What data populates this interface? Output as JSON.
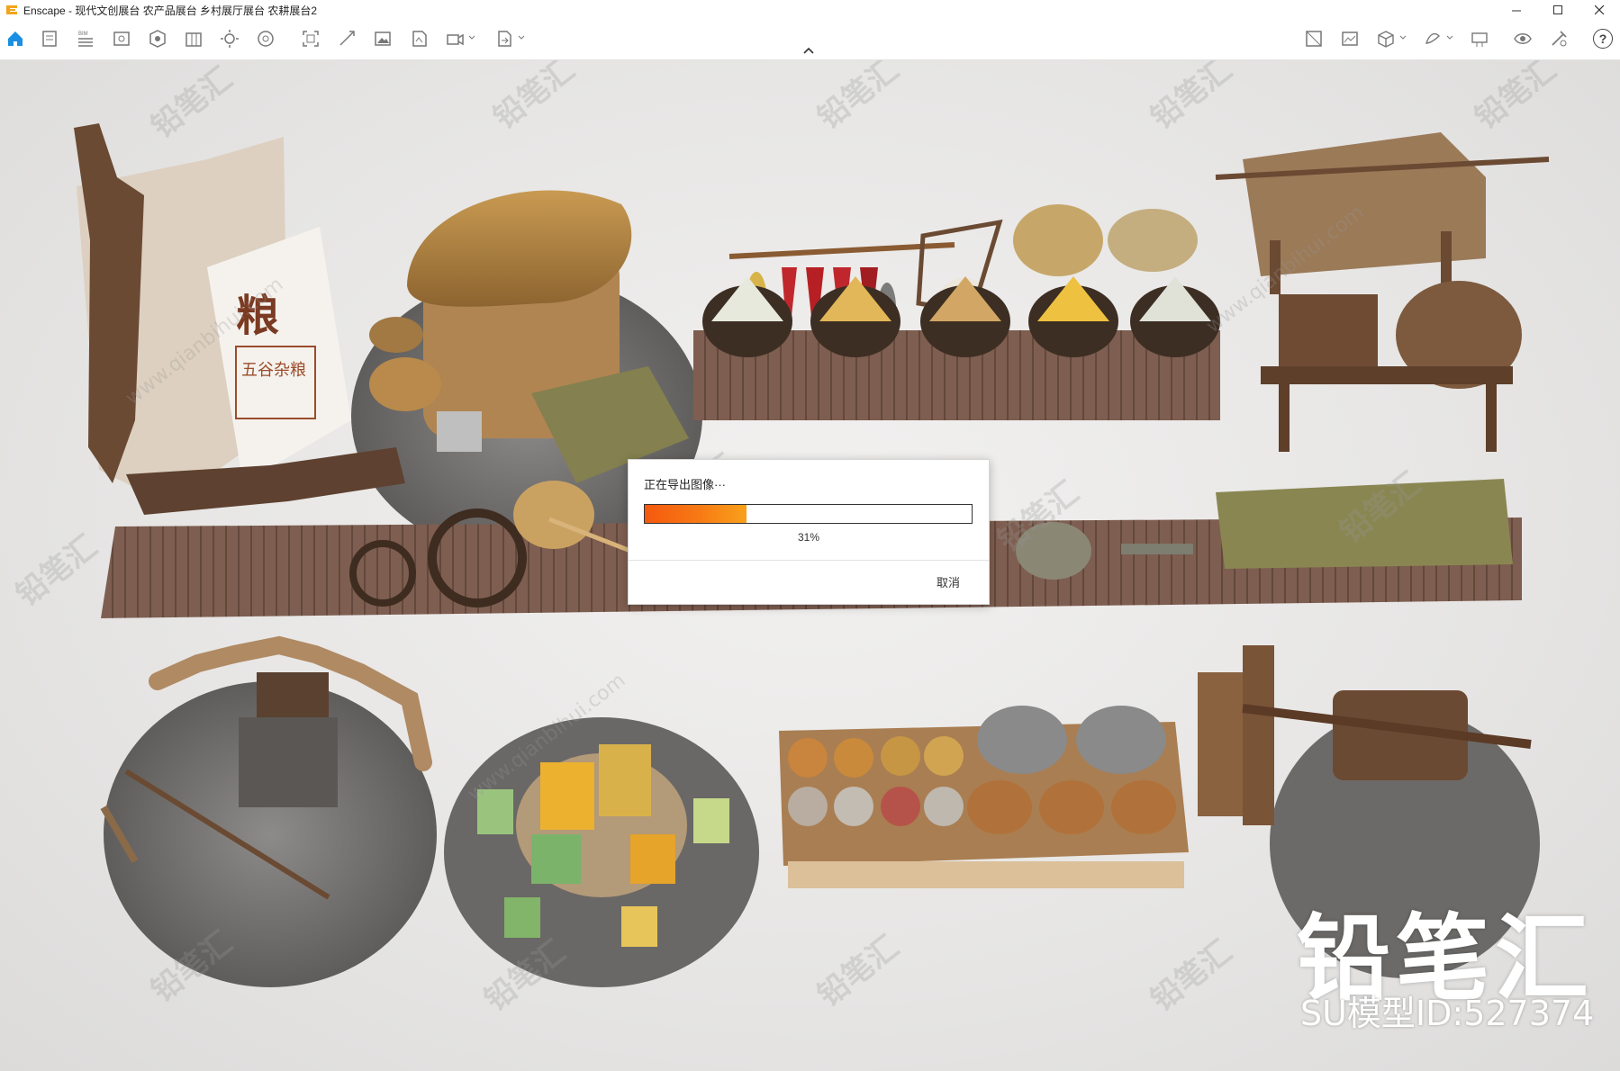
{
  "window": {
    "title": "Enscape - 现代文创展台 农产品展台 乡村展厅展台 农耕展台2",
    "controls": [
      "minimize-icon",
      "maximize-icon",
      "close-icon"
    ]
  },
  "toolbar": {
    "left_tools": [
      "home-icon",
      "settings-icon",
      "bim-icon",
      "views-icon",
      "assets-icon",
      "library-icon",
      "sun-icon",
      "atmosphere-icon",
      "screenshot-icon",
      "batch-render-icon",
      "image-icon",
      "panorama-icon",
      "video-icon",
      "export-icon"
    ],
    "bim_label": "BIM",
    "right_tools": [
      "material-editor-icon",
      "visual-settings-icon",
      "cube-icon",
      "vr-icon",
      "collaboration-icon",
      "eye-icon",
      "feedback-icon"
    ],
    "help_label": "?"
  },
  "dialog": {
    "title": "正在导出图像···",
    "progress": 0.31,
    "progress_label": "31%",
    "cancel_label": "取消"
  },
  "viewport": {
    "brand_mark": "铅笔汇",
    "brand_id": "SU模型ID:527374",
    "watermark_text": "铅笔汇",
    "watermark_url": "www.qianbihui.com",
    "panel_character": "粮",
    "panel_subtitle": "五谷杂粮"
  },
  "colors": {
    "accent_home": "#1a8fe3",
    "progress_start": "#f5590f",
    "progress_end": "#f9a11b",
    "wood_dark": "#6b4a33",
    "wood_light": "#b48a5e",
    "stone": "#6f6d6b"
  }
}
